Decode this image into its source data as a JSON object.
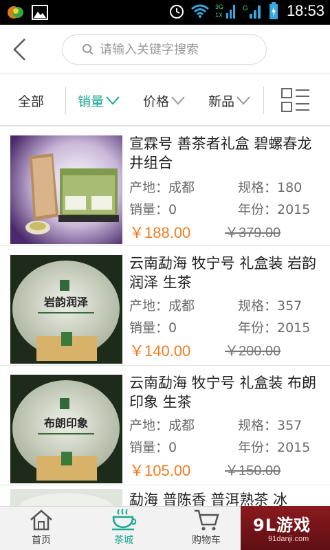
{
  "status_bar": {
    "time": "18:53",
    "network": "3G"
  },
  "header": {
    "search_placeholder": "请输入关键字搜索"
  },
  "filters": [
    {
      "label": "全部",
      "active": false,
      "has_chevron": false
    },
    {
      "label": "销量",
      "active": true,
      "has_chevron": true
    },
    {
      "label": "价格",
      "active": false,
      "has_chevron": true
    },
    {
      "label": "新品",
      "active": false,
      "has_chevron": true
    }
  ],
  "products": [
    {
      "title": "宣霖号 善茶者礼盒 碧螺春龙井组合",
      "origin": "产地：成都",
      "spec": "规格：180",
      "sales": "销量：0",
      "year": "年份：2015",
      "price": "￥188.00",
      "old_price": "￥379.00",
      "image_label": ""
    },
    {
      "title": "云南勐海 牧宁号 礼盒装 岩韵润泽 生茶",
      "origin": "产地：成都",
      "spec": "规格：357",
      "sales": "销量：0",
      "year": "年份：2015",
      "price": "￥140.00",
      "old_price": "￥200.00",
      "image_label": "岩韵润泽"
    },
    {
      "title": "云南勐海 牧宁号 礼盒装 布朗印象 生茶",
      "origin": "产地：成都",
      "spec": "规格：357",
      "sales": "销量：0",
      "year": "年份：2015",
      "price": "￥105.00",
      "old_price": "￥150.00",
      "image_label": "布朗印象"
    },
    {
      "title": "勐海 普陈香 普洱熟茶 冰"
    }
  ],
  "tabs": [
    {
      "label": "首页",
      "active": false
    },
    {
      "label": "茶城",
      "active": true
    },
    {
      "label": "购物车",
      "active": false
    }
  ],
  "watermark": {
    "main": "9L游戏",
    "sub": "91danji.com"
  },
  "colors": {
    "accent": "#1aa890",
    "price": "#f47b20"
  }
}
